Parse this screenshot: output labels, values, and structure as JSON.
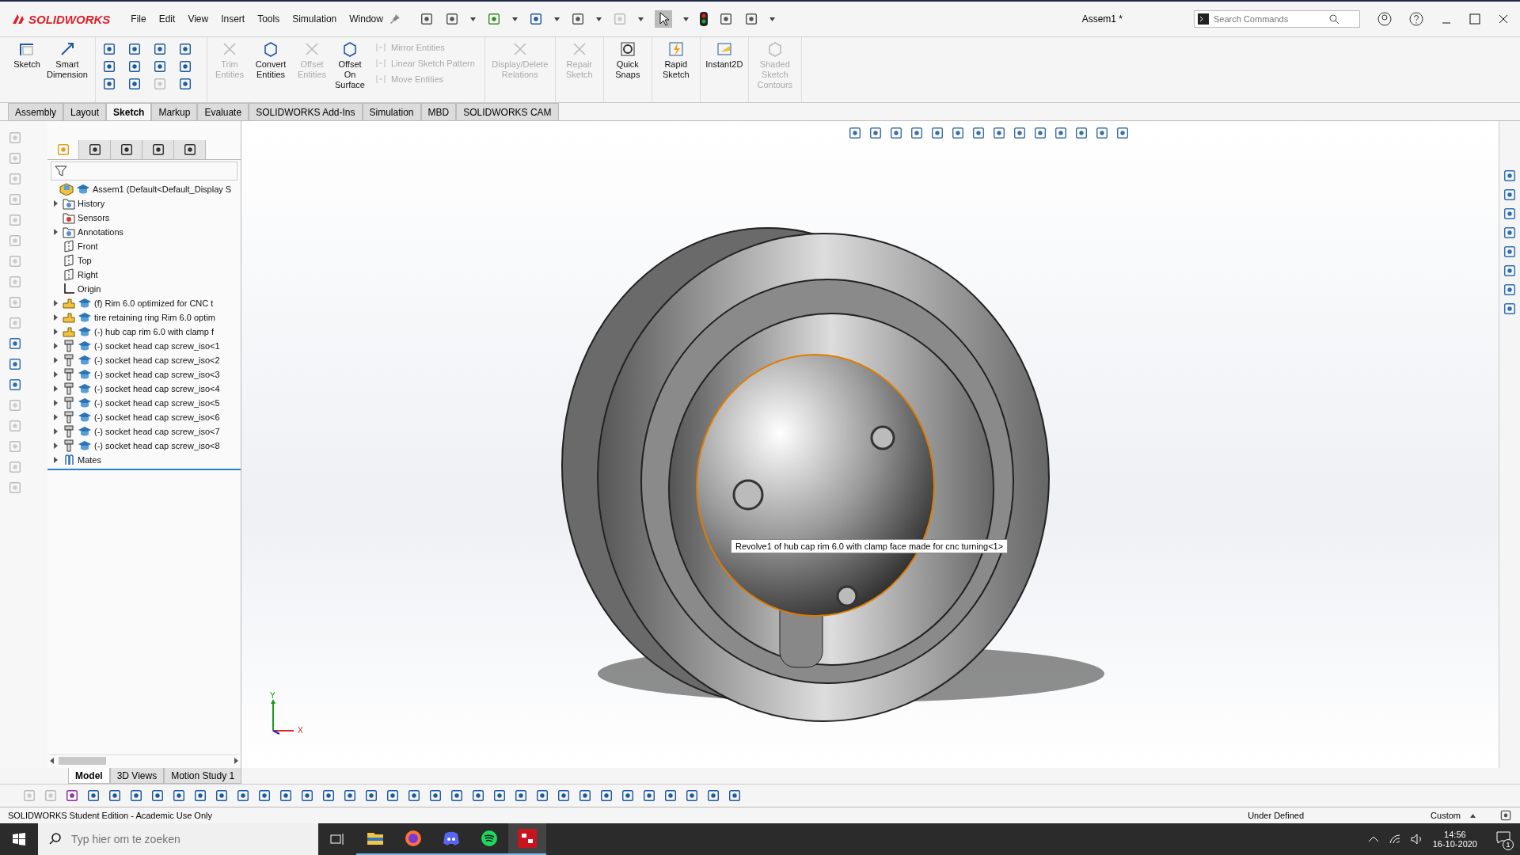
{
  "app": {
    "logo": "SOLIDWORKS",
    "menu": [
      "File",
      "Edit",
      "View",
      "Insert",
      "Tools",
      "Simulation",
      "Window"
    ],
    "document_title": "Assem1 *",
    "search": {
      "placeholder": "Search Commands"
    }
  },
  "command_manager": {
    "large_buttons": [
      {
        "label": "Sketch",
        "disabled": false,
        "kind": "sketch"
      },
      {
        "label": "Smart Dimension",
        "disabled": false,
        "kind": "dimension"
      },
      {
        "label": "Trim Entities",
        "disabled": true,
        "kind": "trim"
      },
      {
        "label": "Convert Entities",
        "disabled": false,
        "kind": "convert"
      },
      {
        "label": "Offset Entities",
        "disabled": true,
        "kind": "offset"
      },
      {
        "label": "Offset On Surface",
        "disabled": false,
        "kind": "surface"
      }
    ],
    "stacked": [
      {
        "label": "Mirror Entities",
        "disabled": true
      },
      {
        "label": "Linear Sketch Pattern",
        "disabled": true
      },
      {
        "label": "Move Entities",
        "disabled": true
      }
    ],
    "right_buttons": [
      {
        "label": "Display/Delete Relations",
        "disabled": true,
        "kind": "relations"
      },
      {
        "label": "Repair Sketch",
        "disabled": true,
        "kind": "repair"
      },
      {
        "label": "Quick Snaps",
        "disabled": false,
        "kind": "snaps"
      },
      {
        "label": "Rapid Sketch",
        "disabled": false,
        "kind": "rapid"
      },
      {
        "label": "Instant2D",
        "disabled": false,
        "kind": "instant"
      },
      {
        "label": "Shaded Sketch Contours",
        "disabled": true,
        "kind": "shaded"
      }
    ]
  },
  "tabs": [
    {
      "label": "Assembly",
      "selected": false
    },
    {
      "label": "Layout",
      "selected": false
    },
    {
      "label": "Sketch",
      "selected": true
    },
    {
      "label": "Markup",
      "selected": false
    },
    {
      "label": "Evaluate",
      "selected": false
    },
    {
      "label": "SOLIDWORKS Add-Ins",
      "selected": false
    },
    {
      "label": "Simulation",
      "selected": false
    },
    {
      "label": "MBD",
      "selected": false
    },
    {
      "label": "SOLIDWORKS CAM",
      "selected": false
    }
  ],
  "feature_tree": {
    "root": {
      "label": "Assem1  (Default<Default_Display S",
      "children": [
        {
          "label": "History",
          "kind": "history",
          "expanded": false
        },
        {
          "label": "Sensors",
          "kind": "sensors"
        },
        {
          "label": "Annotations",
          "kind": "annotations",
          "expanded": false
        },
        {
          "label": "Front",
          "kind": "plane"
        },
        {
          "label": "Top",
          "kind": "plane"
        },
        {
          "label": "Right",
          "kind": "plane"
        },
        {
          "label": "Origin",
          "kind": "origin"
        },
        {
          "label": "(f) Rim 6.0 optimized for CNC t",
          "kind": "part",
          "expanded": false
        },
        {
          "label": "tire retaining ring Rim 6.0 optim",
          "kind": "part",
          "expanded": false
        },
        {
          "label": "(-) hub cap rim 6.0 with clamp f",
          "kind": "part",
          "expanded": false
        },
        {
          "label": "(-) socket head cap screw_iso<1",
          "kind": "screw",
          "expanded": false
        },
        {
          "label": "(-) socket head cap screw_iso<2",
          "kind": "screw",
          "expanded": false
        },
        {
          "label": "(-) socket head cap screw_iso<3",
          "kind": "screw",
          "expanded": false
        },
        {
          "label": "(-) socket head cap screw_iso<4",
          "kind": "screw",
          "expanded": false
        },
        {
          "label": "(-) socket head cap screw_iso<5",
          "kind": "screw",
          "expanded": false
        },
        {
          "label": "(-) socket head cap screw_iso<6",
          "kind": "screw",
          "expanded": false
        },
        {
          "label": "(-) socket head cap screw_iso<7",
          "kind": "screw",
          "expanded": false
        },
        {
          "label": "(-) socket head cap screw_iso<8",
          "kind": "screw",
          "expanded": false
        },
        {
          "label": "Mates",
          "kind": "mates",
          "expanded": false
        }
      ]
    }
  },
  "viewport": {
    "tooltip": "Revolve1 of hub cap rim 6.0 with clamp face made for cnc  turning<1>",
    "triad": {
      "x": "X",
      "y": "Y"
    }
  },
  "bottom_tabs": [
    {
      "label": "Model",
      "selected": true
    },
    {
      "label": "3D Views",
      "selected": false
    },
    {
      "label": "Motion Study 1",
      "selected": false
    }
  ],
  "status_bar": {
    "edition": "SOLIDWORKS Student Edition - Academic Use Only",
    "state": "Under Defined",
    "units": "Custom"
  },
  "taskbar": {
    "search": {
      "placeholder": "Typ hier om te zoeken"
    },
    "time": "14:56",
    "date": "16-10-2020",
    "notifications": "1"
  }
}
